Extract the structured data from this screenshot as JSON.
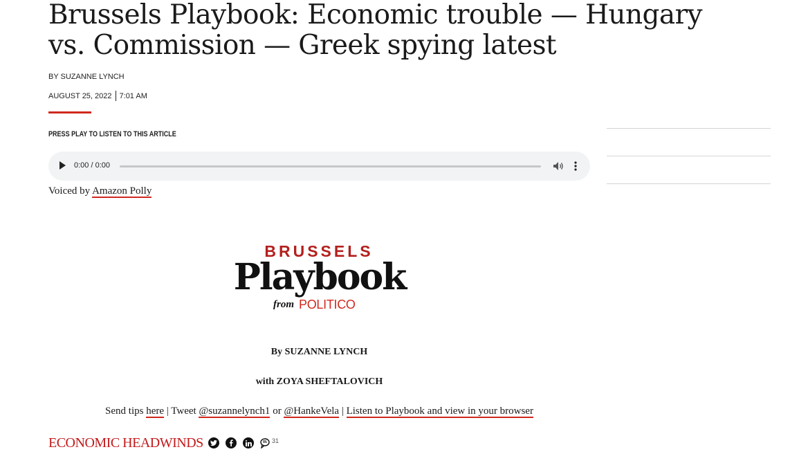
{
  "article": {
    "headline": "Brussels Playbook: Economic trouble — Hungary vs. Commission — Greek spying latest",
    "byline": "BY SUZANNE LYNCH",
    "date": "AUGUST 25, 2022",
    "time": "7:01 AM"
  },
  "audio": {
    "prompt": "PRESS PLAY TO LISTEN TO THIS ARTICLE",
    "time_display": "0:00 / 0:00",
    "progress": 0,
    "voiced_prefix": "Voiced by",
    "voiced_link": "Amazon Polly"
  },
  "logo": {
    "top": "BRUSSELS",
    "main": "Playbook",
    "from": "from",
    "brand": "POLITICO"
  },
  "credits": {
    "by": "By SUZANNE LYNCH",
    "with": "with ZOYA SHEFTALOVICH"
  },
  "tips": {
    "prefix": "Send tips",
    "here": "here",
    "sep1": "|",
    "tweet": "Tweet",
    "handle1": "@suzannelynch1",
    "or": "or",
    "handle2": "@HankeVela",
    "sep2": "|",
    "listen_link": "Listen to Playbook and view in your browser"
  },
  "section": {
    "heading": "ECONOMIC HEADWINDS",
    "comment_count": "31",
    "icons": [
      "twitter-icon",
      "facebook-icon",
      "linkedin-icon",
      "comment-icon"
    ]
  },
  "colors": {
    "accent_red": "#d0281e",
    "logo_red": "#b3201d",
    "text": "#1a1a1a",
    "player_bg": "#f1f3f4"
  }
}
